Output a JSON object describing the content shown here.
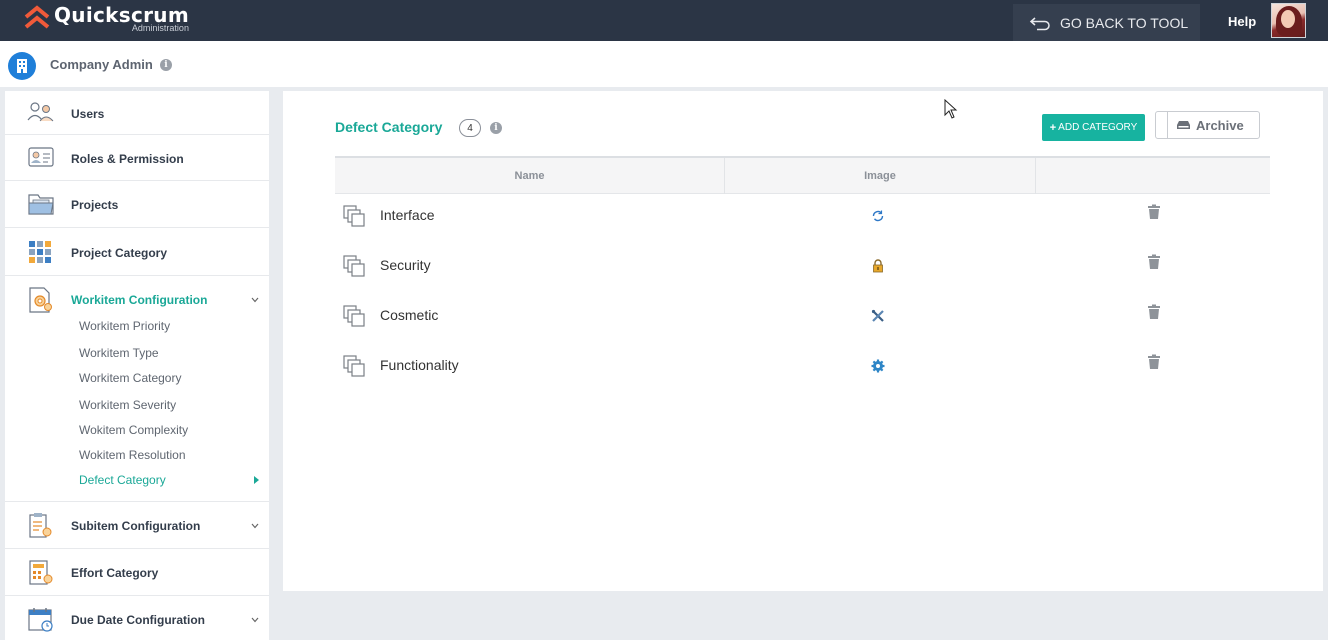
{
  "app": {
    "brand_name": "Quickscrum",
    "brand_sub": "Administration",
    "back_label": "GO BACK TO TOOL",
    "help_label": "Help",
    "accent_color": "#1aa897",
    "topbar_color": "#2b3545"
  },
  "admin": {
    "title": "Company Admin"
  },
  "sidebar": {
    "items": [
      {
        "label": "Users",
        "icon": "users-icon"
      },
      {
        "label": "Roles & Permission",
        "icon": "id-card-icon"
      },
      {
        "label": "Projects",
        "icon": "folder-icon"
      },
      {
        "label": "Project Category",
        "icon": "grid-icon"
      },
      {
        "label": "Workitem Configuration",
        "icon": "gear-doc-icon"
      },
      {
        "label": "Subitem Configuration",
        "icon": "clipboard-gear-icon"
      },
      {
        "label": "Effort Category",
        "icon": "calculator-icon"
      },
      {
        "label": "Due Date Configuration",
        "icon": "calendar-icon"
      }
    ],
    "sub_items": [
      "Workitem Priority",
      "Workitem Type",
      "Workitem Category",
      "Workitem Severity",
      "Wokitem Complexity",
      "Wokitem Resolution",
      "Defect Category"
    ]
  },
  "main": {
    "title": "Defect Category",
    "count": "4",
    "add_label": "ADD CATEGORY",
    "archive_label": "Archive",
    "columns": [
      "Name",
      "Image",
      ""
    ],
    "rows": [
      {
        "name": "Interface",
        "image_icon": "refresh-icon"
      },
      {
        "name": "Security",
        "image_icon": "lock-icon"
      },
      {
        "name": "Cosmetic",
        "image_icon": "tools-icon"
      },
      {
        "name": "Functionality",
        "image_icon": "gear-icon"
      }
    ]
  }
}
